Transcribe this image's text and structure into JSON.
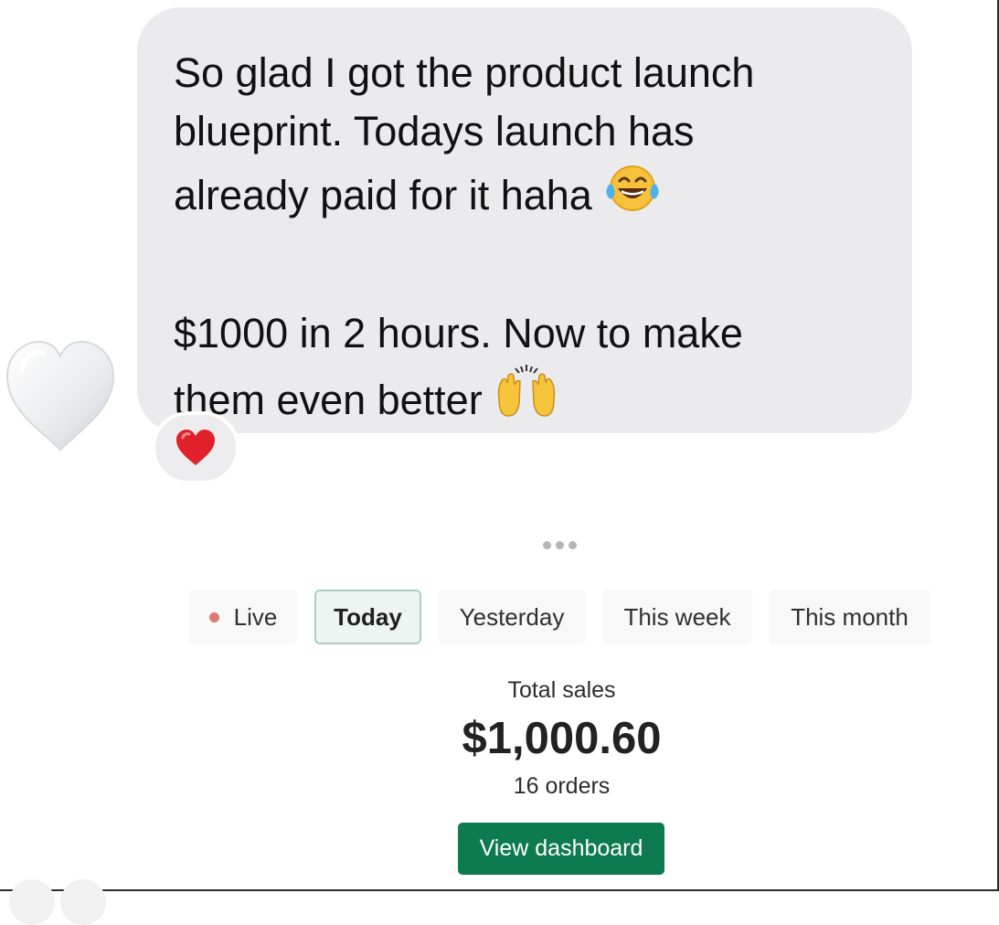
{
  "message": {
    "lines": [
      "So glad I got the product launch",
      "blueprint. Todays launch has",
      "already paid for it haha",
      "$1000 in 2 hours. Now to make",
      "them even better"
    ],
    "emoji": [
      "face-with-tears-of-joy",
      "raising-hands"
    ],
    "reaction_icon": "red-heart",
    "side_icon": "white-heart"
  },
  "sales_card": {
    "tabs": [
      {
        "label": "Live",
        "dot_color": "#dc7a72"
      },
      {
        "label": "Today",
        "active": true
      },
      {
        "label": "Yesterday"
      },
      {
        "label": "This week"
      },
      {
        "label": "This month"
      }
    ],
    "total_label": "Total sales",
    "total_value": "$1,000.60",
    "orders": "16 orders",
    "button_label": "View dashboard"
  },
  "colors": {
    "bubble_bg": "#ebebed",
    "button_bg": "#0e7a4f",
    "active_tab_border": "#a9cfc3",
    "live_dot": "#dc7a72"
  }
}
